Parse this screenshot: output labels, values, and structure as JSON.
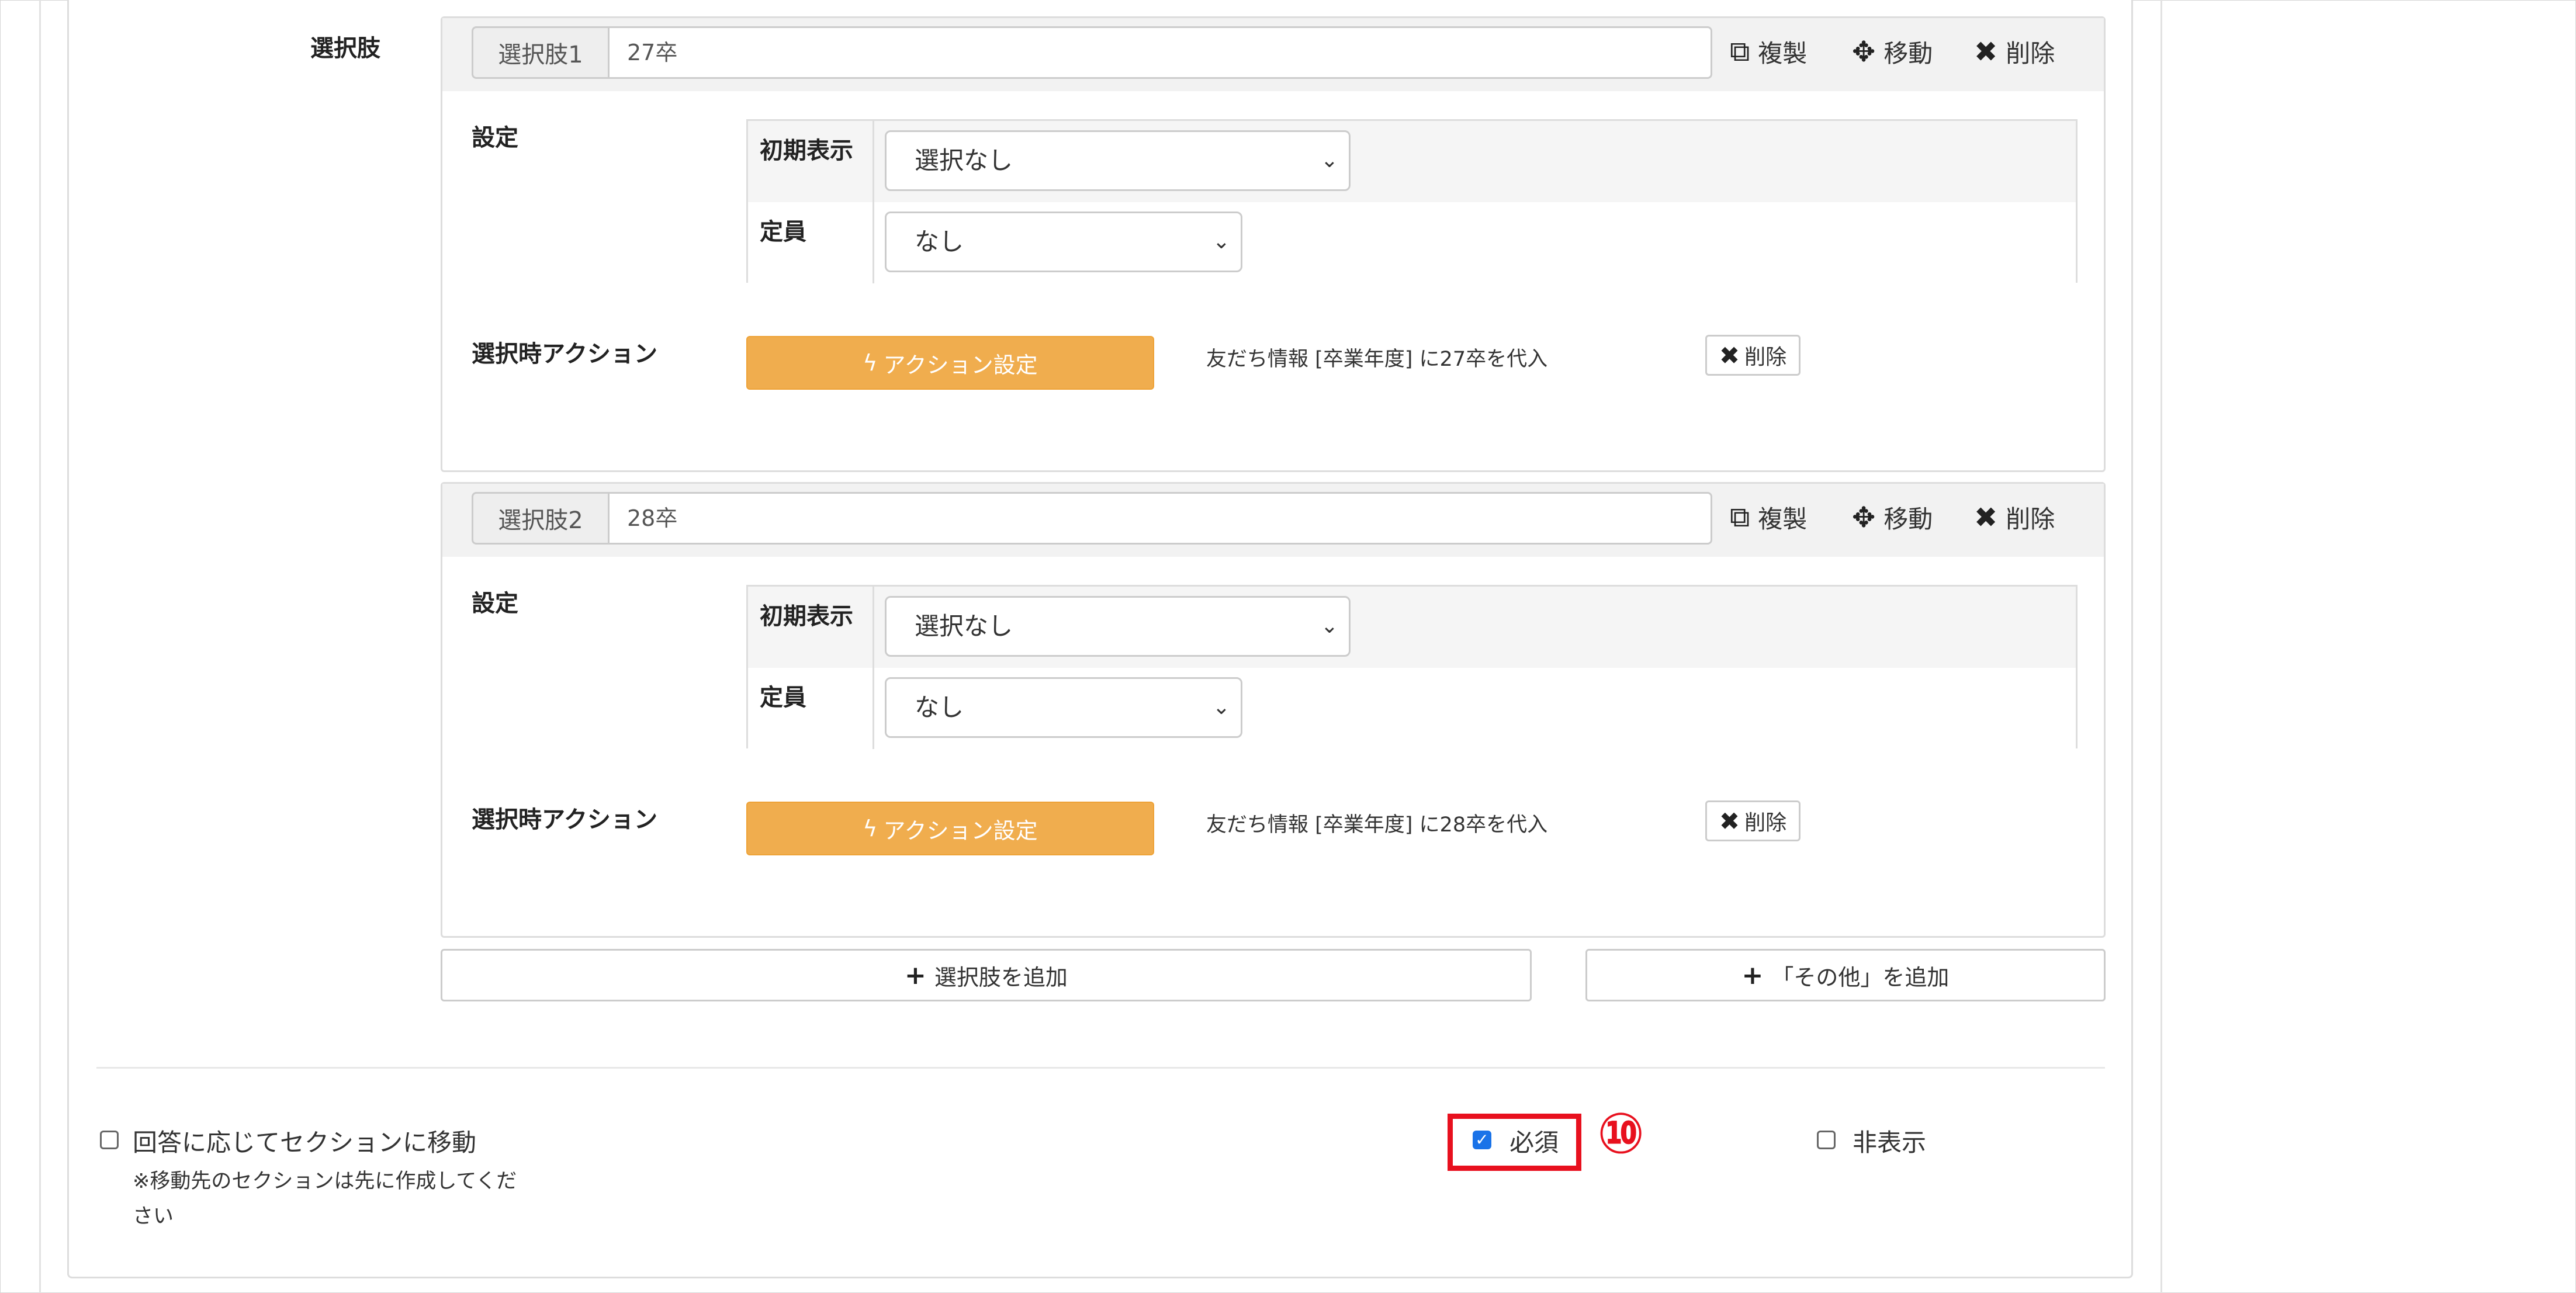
{
  "field_label": "選択肢",
  "choices": [
    {
      "addon_label": "選択肢1",
      "value": "27卒",
      "copy_label": "複製",
      "move_label": "移動",
      "delete_label": "削除",
      "settings_label": "設定",
      "initial_display_label": "初期表示",
      "initial_display_value": "選択なし",
      "capacity_label": "定員",
      "capacity_value": "なし",
      "action_label": "選択時アクション",
      "action_button": "アクション設定",
      "action_text": "友だち情報 [卒業年度] に27卒を代入",
      "action_delete": "削除"
    },
    {
      "addon_label": "選択肢2",
      "value": "28卒",
      "copy_label": "複製",
      "move_label": "移動",
      "delete_label": "削除",
      "settings_label": "設定",
      "initial_display_label": "初期表示",
      "initial_display_value": "選択なし",
      "capacity_label": "定員",
      "capacity_value": "なし",
      "action_label": "選択時アクション",
      "action_button": "アクション設定",
      "action_text": "友だち情報 [卒業年度] に28卒を代入",
      "action_delete": "削除"
    }
  ],
  "add_choice_button": "選択肢を追加",
  "add_other_button": "「その他」を追加",
  "section_jump": {
    "label": "回答に応じてセクションに移動",
    "note_line1": "※移動先のセクションは先に作成してくだ",
    "note_line2": "さい",
    "checked": false
  },
  "required": {
    "label": "必須",
    "checked": true
  },
  "hidden": {
    "label": "非表示",
    "checked": false
  },
  "callout_number": "⑩",
  "icons": {
    "copy": "copy-icon",
    "move": "move-icon",
    "delete": "close-icon",
    "bolt": "bolt-icon",
    "plus": "plus-icon",
    "caret": "chevron-down-icon"
  },
  "colors": {
    "action_button": "#f0ad4e",
    "highlight": "#e8101e",
    "checkbox_checked": "#1a73e8"
  }
}
